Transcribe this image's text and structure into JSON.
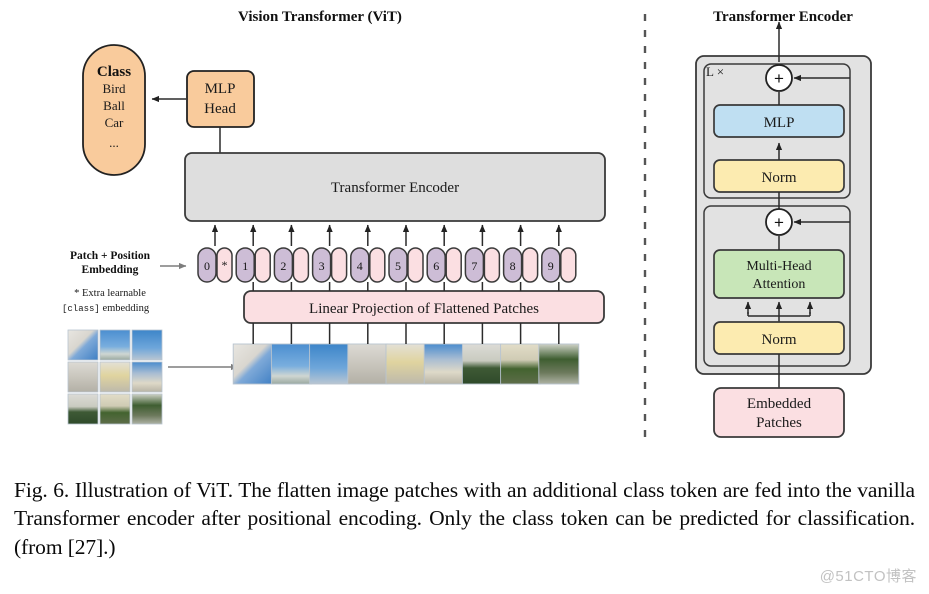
{
  "figure": {
    "left_panel": {
      "title": "Vision Transformer (ViT)",
      "class_box": {
        "heading": "Class",
        "items": [
          "Bird",
          "Ball",
          "Car"
        ],
        "ellipsis": "...",
        "fill": "#f9cb9c"
      },
      "mlp_head": {
        "line1": "MLP",
        "line2": "Head",
        "fill": "#f9cb9c"
      },
      "encoder_box": {
        "label": "Transformer Encoder",
        "fill": "#dedede"
      },
      "embedding_label": {
        "line1": "Patch + Position",
        "line2": "Embedding"
      },
      "extra_note": {
        "line1": "* Extra learnable",
        "line2_mono": "[class]",
        "line2_rest": " embedding"
      },
      "projection_box": {
        "label": "Linear Projection of Flattened Patches",
        "fill": "#fbdfe2"
      },
      "tokens": [
        {
          "num": "0",
          "mark": "*"
        },
        {
          "num": "1",
          "mark": ""
        },
        {
          "num": "2",
          "mark": ""
        },
        {
          "num": "3",
          "mark": ""
        },
        {
          "num": "4",
          "mark": ""
        },
        {
          "num": "5",
          "mark": ""
        },
        {
          "num": "6",
          "mark": ""
        },
        {
          "num": "7",
          "mark": ""
        },
        {
          "num": "8",
          "mark": ""
        },
        {
          "num": "9",
          "mark": ""
        }
      ],
      "token_colors": {
        "num_fill": "#cdbdd6",
        "pos_fill": "#fbdfe2"
      },
      "patch_count": 9,
      "grid_rows": 3,
      "grid_cols": 3
    },
    "right_panel": {
      "title": "Transformer Encoder",
      "repeat_label": "L ×",
      "blocks": [
        {
          "label": "MLP",
          "fill": "#bfdff2"
        },
        {
          "label": "Norm",
          "fill": "#fcebb0"
        },
        {
          "line1": "Multi-Head",
          "line2": "Attention",
          "fill": "#c8e6b8"
        },
        {
          "label": "Norm",
          "fill": "#fcebb0"
        }
      ],
      "input_box": {
        "line1": "Embedded",
        "line2": "Patches",
        "fill": "#fbdfe2"
      },
      "adders": [
        "+",
        "+"
      ],
      "container_fill": "#e2e2e2"
    }
  },
  "caption": {
    "text": "Fig. 6.  Illustration of ViT. The flatten image patches with an additional class token are fed into the vanilla Transformer encoder after positional encoding. Only the class token can be predicted for classification. (from [27].)"
  },
  "watermark": {
    "text": "@51CTO博客"
  }
}
